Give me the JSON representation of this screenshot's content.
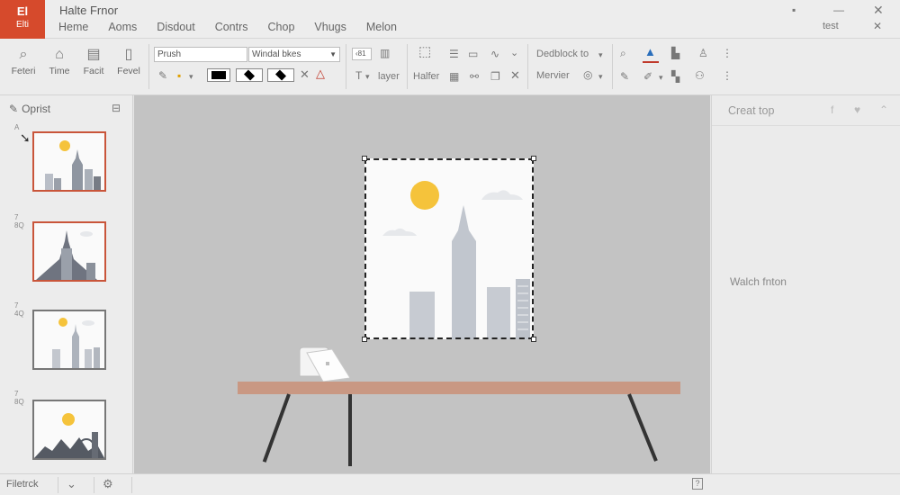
{
  "app": {
    "icon_glyph": "El",
    "icon_label": "Elti",
    "title": "Halte Frnor",
    "accent": "#d64a2c"
  },
  "menu": [
    "Heme",
    "Aoms",
    "Disdout",
    "Contrs",
    "Chop",
    "Vhugs",
    "Melon"
  ],
  "titlebar": {
    "right_label": "test",
    "icons": [
      "chat-icon",
      "minimize-icon",
      "close-icon"
    ]
  },
  "ribbon": {
    "big_buttons": [
      {
        "icon": "search-icon",
        "label": "Feteri"
      },
      {
        "icon": "home-icon",
        "label": "Time"
      },
      {
        "icon": "paste-icon",
        "label": "Facit"
      },
      {
        "icon": "file-icon",
        "label": "Fevel"
      }
    ],
    "font_field": "Prush",
    "style_select": "Windal bkes",
    "size_field": "‹81",
    "layer_label": "layer",
    "halfer_label": "Halfer",
    "dedblock_label": "Dedblock to",
    "mervier_label": "Mervier"
  },
  "left_panel": {
    "title": "Oprist",
    "thumb_numbers": [
      "A",
      "7\n8Q",
      "7\n4Q",
      "7\n8Q"
    ]
  },
  "right_panel": {
    "title": "Creat top",
    "body": "Walch fnton"
  },
  "status": {
    "file": "Filetrck",
    "help": "?"
  }
}
